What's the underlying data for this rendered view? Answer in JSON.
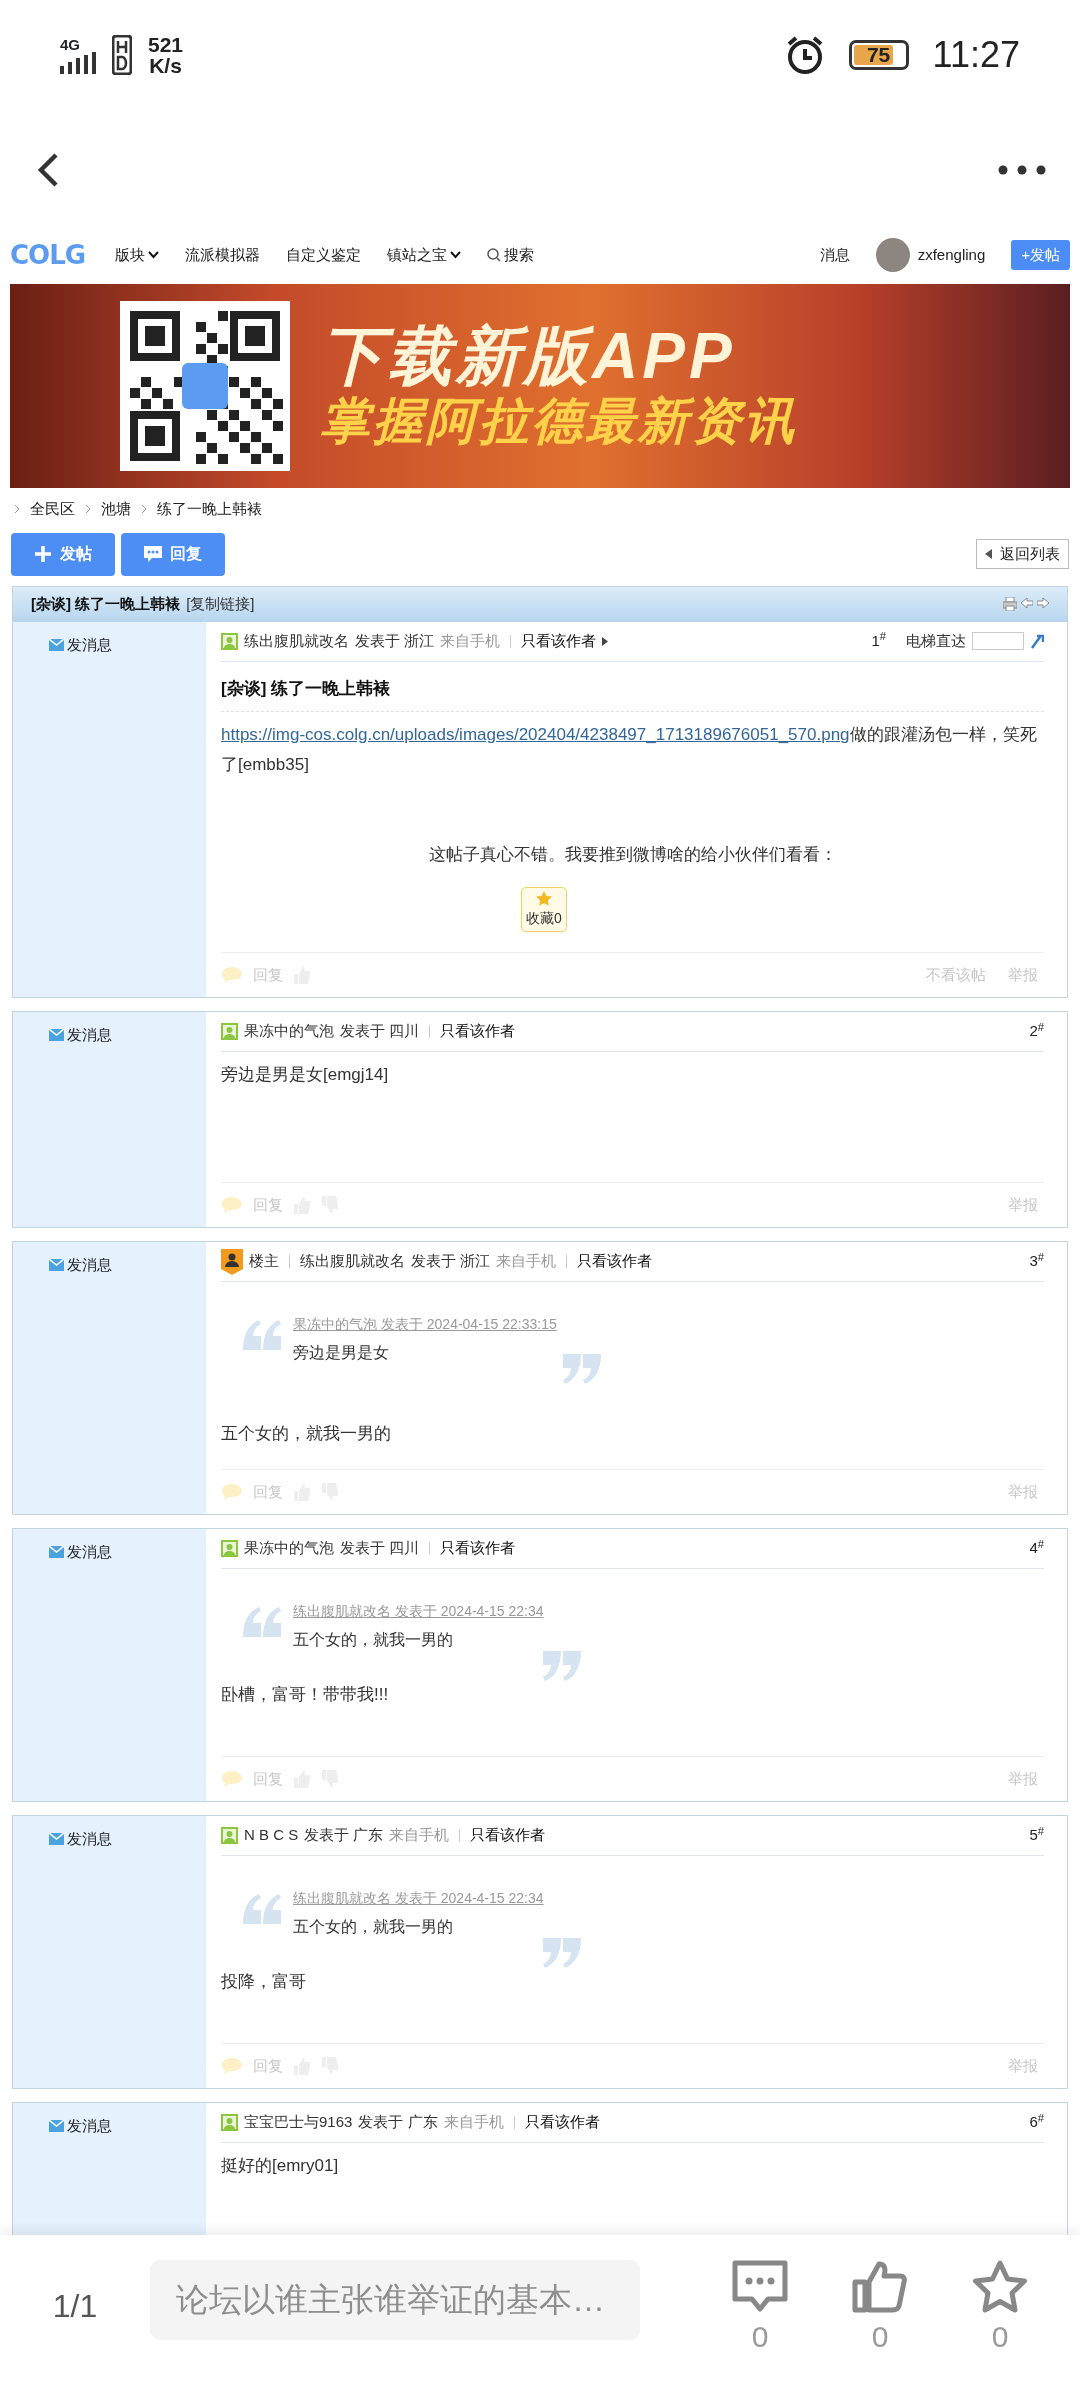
{
  "status_bar": {
    "network": "4G",
    "speed_value": "521",
    "speed_unit": "K/s",
    "battery": "75",
    "time": "11:27"
  },
  "nav": {
    "logo": "COLG",
    "items": [
      {
        "label": "版块",
        "dropdown": true
      },
      {
        "label": "流派模拟器",
        "dropdown": false
      },
      {
        "label": "自定义鉴定",
        "dropdown": false
      },
      {
        "label": "镇站之宝",
        "dropdown": true
      }
    ],
    "search": "搜索",
    "messages": "消息",
    "username": "zxfengling",
    "post_button": "+发帖"
  },
  "banner": {
    "headline": "下载新版APP",
    "subline": "掌握阿拉德最新资讯"
  },
  "breadcrumb": [
    "全民区",
    "池塘",
    "练了一晚上韩裱"
  ],
  "actions": {
    "new_post": "发帖",
    "reply": "回复",
    "back_to_list": "返回列表"
  },
  "thread": {
    "title": "[杂谈] 练了一晚上韩裱",
    "copy_link": "[复制链接]"
  },
  "posts": [
    {
      "kind": "member",
      "author": "练出腹肌就改名",
      "posted": "发表于 浙江",
      "source": "来自手机",
      "only_author": "只看该作者",
      "floor": "1$^{#}$",
      "send_message": "发消息",
      "elevator": "电梯直达",
      "title": "[杂谈] 练了一晚上韩裱",
      "link": "https://img-cos.colg.cn/uploads/images/202404/4238497_1713189676051_570.png",
      "text": "做的跟灌汤包一样，笑死了[embb35]",
      "share": "这帖子真心不错。我要推到微博啥的给小伙伴们看看：",
      "favorite": "收藏0",
      "footer": {
        "reply": "回复",
        "hide": "不看该帖",
        "report": "举报"
      }
    },
    {
      "kind": "member",
      "author": "果冻中的气泡",
      "posted": "发表于 四川",
      "only_author": "只看该作者",
      "floor": "2$^{#}$",
      "send_message": "发消息",
      "text": "旁边是男是女[emgj14]",
      "footer": {
        "reply": "回复",
        "report": "举报"
      }
    },
    {
      "kind": "op",
      "op_label": "楼主",
      "author": "练出腹肌就改名",
      "posted": "发表于 浙江",
      "source": "来自手机",
      "only_author": "只看该作者",
      "floor": "3$^{#}$",
      "send_message": "发消息",
      "quote": {
        "cite": "果冻中的气泡 发表于 2024-04-15 22:33:15",
        "text": "旁边是男是女"
      },
      "text": "五个女的，就我一男的",
      "footer": {
        "reply": "回复",
        "report": "举报"
      }
    },
    {
      "kind": "member",
      "author": "果冻中的气泡",
      "posted": "发表于 四川",
      "only_author": "只看该作者",
      "floor": "4$^{#}$",
      "send_message": "发消息",
      "quote": {
        "cite": "练出腹肌就改名 发表于 2024-4-15 22:34",
        "text": "五个女的，就我一男的"
      },
      "text": "卧槽，富哥！带带我!!!",
      "footer": {
        "reply": "回复",
        "report": "举报"
      }
    },
    {
      "kind": "member",
      "author": "N B C S",
      "posted": "发表于 广东",
      "source": "来自手机",
      "only_author": "只看该作者",
      "floor": "5$^{#}$",
      "send_message": "发消息",
      "quote": {
        "cite": "练出腹肌就改名 发表于 2024-4-15 22:34",
        "text": "五个女的，就我一男的"
      },
      "text": "投降，富哥",
      "footer": {
        "reply": "回复",
        "report": "举报"
      }
    },
    {
      "kind": "member",
      "author": "宝宝巴士与9163",
      "posted": "发表于 广东",
      "source": "来自手机",
      "only_author": "只看该作者",
      "floor": "6$^{#}$",
      "send_message": "发消息",
      "text": "挺好的[emry01]"
    }
  ],
  "bottom_bar": {
    "page": "1/1",
    "placeholder": "论坛以谁主张谁举证的基本…",
    "actions": [
      {
        "kind": "comment",
        "count": "0"
      },
      {
        "kind": "like",
        "count": "0"
      },
      {
        "kind": "star",
        "count": "0"
      }
    ]
  }
}
